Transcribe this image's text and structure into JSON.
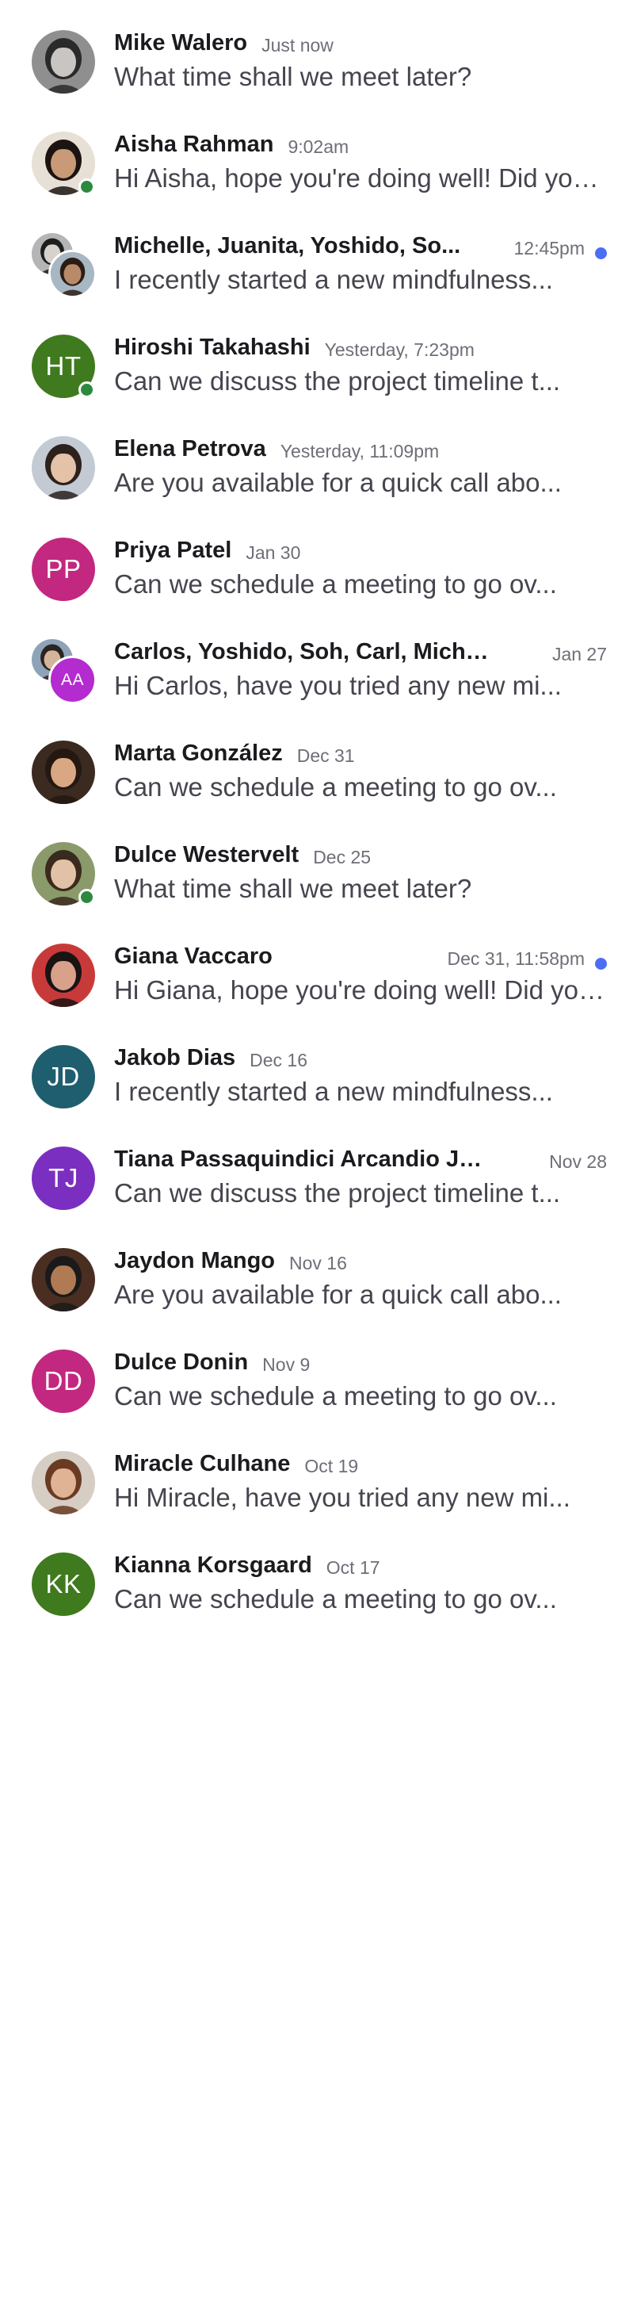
{
  "conversations": [
    {
      "name": "Mike Walero",
      "time": "Just now",
      "preview": "What time shall we meet later?",
      "avatar": {
        "type": "photo",
        "skin": "#c9c5c2",
        "hair": "#2a2a2a",
        "bg": "#8f8f8f"
      },
      "online": false,
      "unread": false
    },
    {
      "name": "Aisha Rahman",
      "time": "9:02am",
      "preview": "Hi Aisha, hope you're doing well! Did you...",
      "avatar": {
        "type": "photo",
        "skin": "#c99a78",
        "hair": "#1c1410",
        "bg": "#e6e0d6"
      },
      "online": true,
      "unread": false
    },
    {
      "name": "Michelle, Juanita, Yoshido, So...",
      "time": "12:45pm",
      "preview": "I recently started a new mindfulness...",
      "avatar": {
        "type": "group",
        "a": {
          "type": "photo",
          "skin": "#d8d2cc",
          "hair": "#1e1e1e",
          "bg": "#b5b5b5"
        },
        "b": {
          "type": "photo",
          "skin": "#b98a6a",
          "hair": "#2b1d16",
          "bg": "#a7b7c4"
        }
      },
      "online": false,
      "unread": true
    },
    {
      "name": "Hiroshi Takahashi",
      "time": "Yesterday, 7:23pm",
      "preview": "Can we discuss the project timeline t...",
      "avatar": {
        "type": "initials",
        "initials": "HT",
        "color": "#3f7a1e"
      },
      "online": true,
      "unread": false
    },
    {
      "name": "Elena Petrova",
      "time": "Yesterday, 11:09pm",
      "preview": "Are you available for a quick call abo...",
      "avatar": {
        "type": "photo",
        "skin": "#e4c2a8",
        "hair": "#2c211c",
        "bg": "#c3cad3"
      },
      "online": false,
      "unread": false
    },
    {
      "name": "Priya Patel",
      "time": "Jan 30",
      "preview": "Can we schedule a meeting to go ov...",
      "avatar": {
        "type": "initials",
        "initials": "PP",
        "color": "#c2287f"
      },
      "online": false,
      "unread": false
    },
    {
      "name": "Carlos, Yoshido, Soh, Carl, Michel...",
      "time": "Jan 27",
      "preview": "Hi Carlos, have you tried any new mi...",
      "avatar": {
        "type": "group",
        "a": {
          "type": "photo",
          "skin": "#d4b59c",
          "hair": "#2b2420",
          "bg": "#8fa3b8"
        },
        "b": {
          "type": "initials",
          "initials": "AA",
          "color": "#b42bd0"
        }
      },
      "online": false,
      "unread": false
    },
    {
      "name": "Marta González",
      "time": "Dec 31",
      "preview": "Can we schedule a meeting to go ov...",
      "avatar": {
        "type": "photo",
        "skin": "#d9a784",
        "hair": "#241810",
        "bg": "#3a2a20"
      },
      "online": false,
      "unread": false
    },
    {
      "name": "Dulce Westervelt",
      "time": "Dec 25",
      "preview": "What time shall we meet later?",
      "avatar": {
        "type": "photo",
        "skin": "#e2c2a6",
        "hair": "#3a2a1e",
        "bg": "#8a9a6a"
      },
      "online": true,
      "unread": false
    },
    {
      "name": "Giana Vaccaro",
      "time": "Dec 31, 11:58pm",
      "preview": "Hi Giana, hope you're doing well! Did you...",
      "avatar": {
        "type": "photo",
        "skin": "#d9a08a",
        "hair": "#1a1414",
        "bg": "#c83a3a"
      },
      "online": false,
      "unread": true
    },
    {
      "name": "Jakob Dias",
      "time": "Dec 16",
      "preview": "I recently started a new mindfulness...",
      "avatar": {
        "type": "initials",
        "initials": "JD",
        "color": "#1e5e6e"
      },
      "online": false,
      "unread": false
    },
    {
      "name": "Tiana Passaquindici Arcandio Jun...",
      "time": "Nov 28",
      "preview": "Can we discuss the project timeline t...",
      "avatar": {
        "type": "initials",
        "initials": "TJ",
        "color": "#7a2fc0"
      },
      "online": false,
      "unread": false
    },
    {
      "name": "Jaydon Mango",
      "time": "Nov 16",
      "preview": "Are you available for a quick call abo...",
      "avatar": {
        "type": "photo",
        "skin": "#b07a55",
        "hair": "#1a1a1a",
        "bg": "#4a2e22"
      },
      "online": false,
      "unread": false
    },
    {
      "name": "Dulce Donin",
      "time": "Nov 9",
      "preview": "Can we schedule a meeting to go ov...",
      "avatar": {
        "type": "initials",
        "initials": "DD",
        "color": "#c2287f"
      },
      "online": false,
      "unread": false
    },
    {
      "name": "Miracle Culhane",
      "time": "Oct 19",
      "preview": "Hi Miracle, have you tried any new mi...",
      "avatar": {
        "type": "photo",
        "skin": "#e0b394",
        "hair": "#6a3a22",
        "bg": "#d6cdc4"
      },
      "online": false,
      "unread": false
    },
    {
      "name": "Kianna Korsgaard",
      "time": "Oct 17",
      "preview": "Can we schedule a meeting to go ov...",
      "avatar": {
        "type": "initials",
        "initials": "KK",
        "color": "#3f7a1e"
      },
      "online": false,
      "unread": false
    }
  ],
  "colors": {
    "online": "#2b8a3e",
    "unread": "#4c6ef5",
    "name_text": "#1b1b1f",
    "time_text": "#6e6e78",
    "preview_text": "#45454f"
  },
  "icons": {
    "online_indicator": "online-status-icon",
    "unread_indicator": "unread-icon"
  }
}
